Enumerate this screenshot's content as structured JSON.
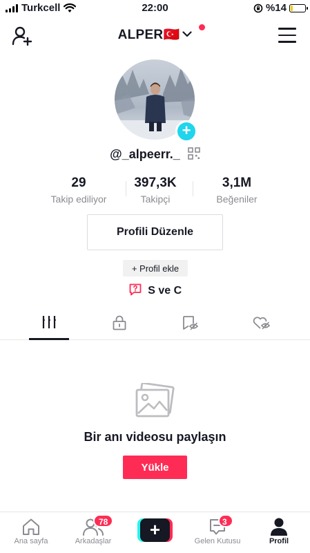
{
  "status_bar": {
    "carrier": "Turkcell",
    "time": "22:00",
    "battery_text": "%14",
    "battery_level": 0.14
  },
  "header": {
    "account_name": "ALPER",
    "account_flag": "🇹🇷"
  },
  "profile": {
    "username": "@_alpeerr._",
    "stats": [
      {
        "value": "29",
        "label": "Takip ediliyor"
      },
      {
        "value": "397,3K",
        "label": "Takipçi"
      },
      {
        "value": "3,1M",
        "label": "Beğeniler"
      }
    ],
    "edit_button": "Profili Düzenle",
    "add_bio_button": "+ Profil ekle",
    "qa_label": "S ve C"
  },
  "tabs": [
    {
      "icon": "grid-icon",
      "active": true
    },
    {
      "icon": "lock-icon",
      "active": false
    },
    {
      "icon": "bookmark-hidden-icon",
      "active": false
    },
    {
      "icon": "heart-hidden-icon",
      "active": false
    }
  ],
  "empty_state": {
    "icon": "photo-icon",
    "title": "Bir anı videosu paylaşın",
    "button": "Yükle"
  },
  "bottom_nav": {
    "home": "Ana sayfa",
    "friends": "Arkadaşlar",
    "friends_badge": "78",
    "inbox": "Gelen Kutusu",
    "inbox_badge": "3",
    "profile": "Profil"
  },
  "colors": {
    "accent": "#fe2c55",
    "cyan": "#25f4ee",
    "badge_blue": "#20d5ec",
    "text": "#161823",
    "muted": "#8a8b91"
  }
}
